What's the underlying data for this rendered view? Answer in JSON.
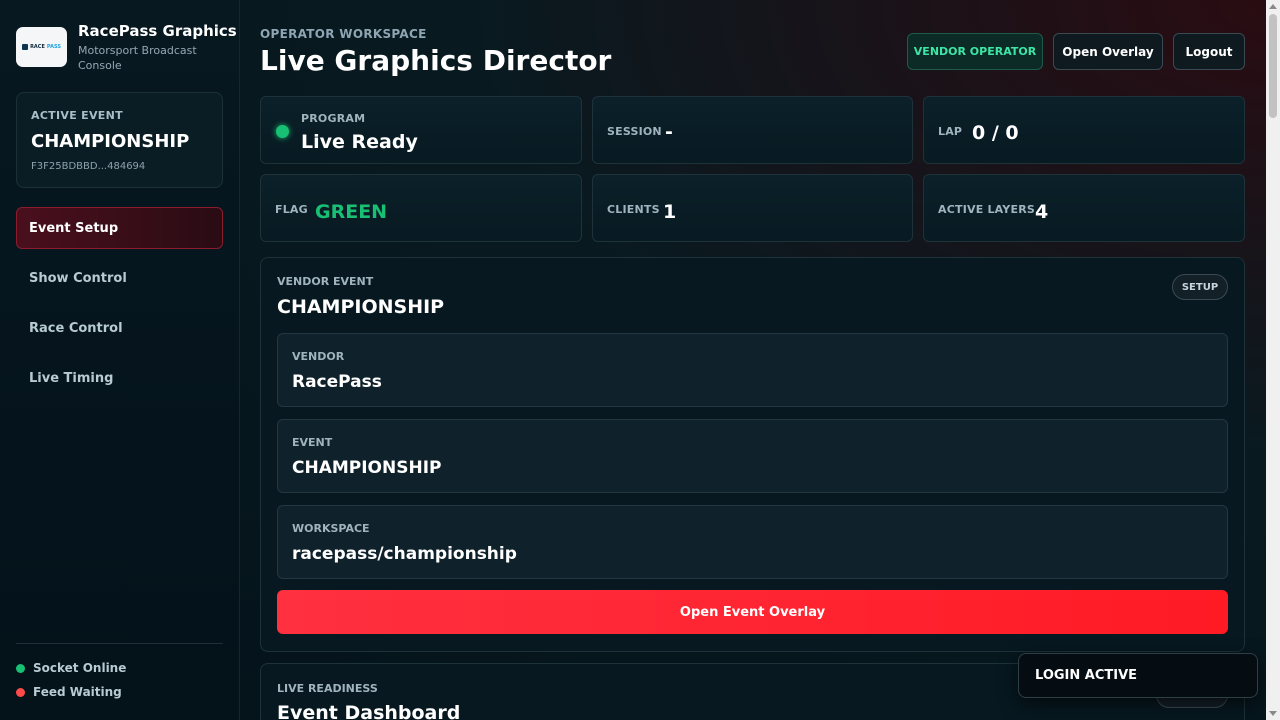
{
  "brand": {
    "title": "RacePass Graphics",
    "subtitle": "Motorsport Broadcast Console",
    "logo_text_a": "RACE",
    "logo_text_b": "PASS"
  },
  "active_event": {
    "label": "ACTIVE EVENT",
    "name": "CHAMPIONSHIP",
    "id": "F3F25BDBBD...484694"
  },
  "nav": {
    "items": [
      {
        "label": "Event Setup",
        "active": true
      },
      {
        "label": "Show Control",
        "active": false
      },
      {
        "label": "Race Control",
        "active": false
      },
      {
        "label": "Live Timing",
        "active": false
      }
    ]
  },
  "status": {
    "socket": {
      "label": "Socket Online",
      "color": "#18c074"
    },
    "feed": {
      "label": "Feed Waiting",
      "color": "#ff4a4a"
    }
  },
  "header": {
    "workspace_label": "OPERATOR WORKSPACE",
    "title": "Live Graphics Director",
    "vendor_button": "VENDOR OPERATOR",
    "overlay_button": "Open Overlay",
    "logout_button": "Logout"
  },
  "stats": {
    "program": {
      "label": "PROGRAM",
      "value": "Live Ready"
    },
    "session": {
      "label": "SESSION",
      "value": "-"
    },
    "lap": {
      "label": "LAP",
      "value": "0 / 0"
    },
    "flag": {
      "label": "FLAG",
      "value": "GREEN",
      "color": "#18c074"
    },
    "clients": {
      "label": "CLIENTS",
      "value": "1"
    },
    "active_layers": {
      "label": "ACTIVE LAYERS",
      "value": "4"
    }
  },
  "vendor_panel": {
    "label": "VENDOR EVENT",
    "title": "CHAMPIONSHIP",
    "setup_pill": "SETUP",
    "fields": [
      {
        "label": "VENDOR",
        "value": "RacePass"
      },
      {
        "label": "EVENT",
        "value": "CHAMPIONSHIP"
      },
      {
        "label": "WORKSPACE",
        "value": "racepass/championship"
      }
    ],
    "button": "Open Event Overlay"
  },
  "readiness_panel": {
    "label": "LIVE READINESS",
    "title": "Event Dashboard"
  },
  "toast": {
    "text": "LOGIN ACTIVE"
  },
  "colors": {
    "accent_red": "#ff1a24",
    "accent_green": "#18c074"
  }
}
